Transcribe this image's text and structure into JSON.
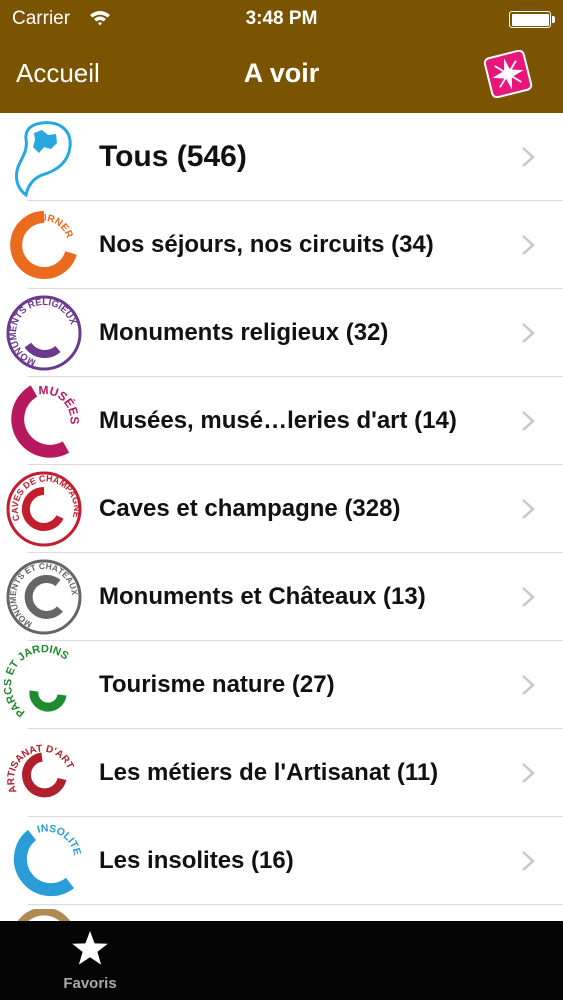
{
  "status_bar": {
    "carrier": "Carrier",
    "time": "3:48 PM"
  },
  "nav": {
    "back_label": "Accueil",
    "title": "A voir",
    "action_icon": "sparkle-icon"
  },
  "list": {
    "items": [
      {
        "label": "Tous (546)",
        "icon": "region-map-icon",
        "color": "#29a8e0"
      },
      {
        "label": "Nos séjours, nos circuits (34)",
        "icon": "sejourner-logo",
        "logo_text": "SÉJOURNER",
        "color": "#ea6a1e"
      },
      {
        "label": "Monuments religieux (32)",
        "icon": "monuments-religieux-logo",
        "logo_text": "MONUMENTS RELIGIEUX",
        "color": "#6a3a8e"
      },
      {
        "label": "Musées, musé…leries d'art (14)",
        "icon": "musees-logo",
        "logo_text": "MUSÉES",
        "color": "#b8195e"
      },
      {
        "label": "Caves et champagne (328)",
        "icon": "caves-champagne-logo",
        "logo_text": "CAVES DE CHAMPAGNE",
        "color": "#c41d2e"
      },
      {
        "label": "Monuments et Châteaux (13)",
        "icon": "monuments-chateaux-logo",
        "logo_text": "MONUMENTS ET CHÂTEAUX",
        "color": "#666666"
      },
      {
        "label": "Tourisme nature (27)",
        "icon": "parcs-jardins-logo",
        "logo_text": "PARCS ET JARDINS",
        "color": "#1f8a2e"
      },
      {
        "label": "Les métiers de l'Artisanat (11)",
        "icon": "artisanat-logo",
        "logo_text": "ARTISANAT D'ART",
        "color": "#b0202c"
      },
      {
        "label": "Les insolites (16)",
        "icon": "insolite-logo",
        "logo_text": "INSOLITE",
        "color": "#2a9cd8"
      }
    ]
  },
  "tabbar": {
    "tabs": [
      {
        "label": "Favoris",
        "icon": "star-icon"
      }
    ]
  }
}
